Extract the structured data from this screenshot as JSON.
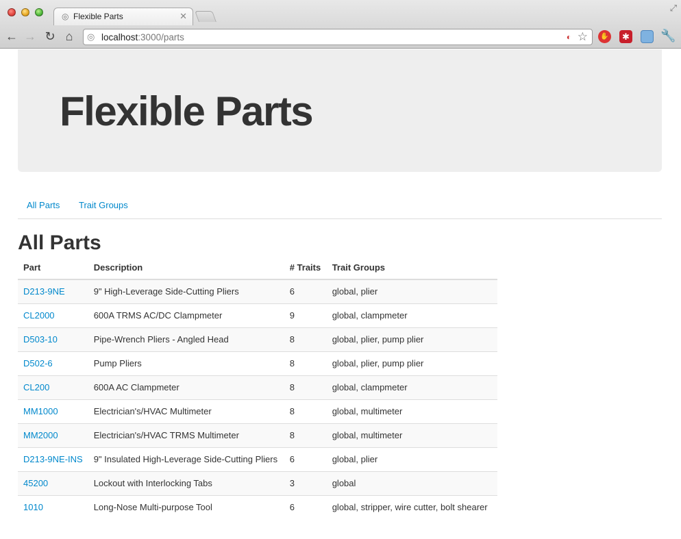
{
  "browser": {
    "tab_title": "Flexible Parts",
    "url_host": "localhost",
    "url_path": ":3000/parts"
  },
  "hero": {
    "title": "Flexible Parts"
  },
  "nav": {
    "all_parts": "All Parts",
    "trait_groups": "Trait Groups"
  },
  "page": {
    "title": "All Parts"
  },
  "table": {
    "headers": [
      "Part",
      "Description",
      "# Traits",
      "Trait Groups"
    ],
    "rows": [
      [
        "D213-9NE",
        "9\" High-Leverage Side-Cutting Pliers",
        "6",
        "global, plier"
      ],
      [
        "CL2000",
        "600A TRMS AC/DC Clampmeter",
        "9",
        "global, clampmeter"
      ],
      [
        "D503-10",
        "Pipe-Wrench Pliers - Angled Head",
        "8",
        "global, plier, pump plier"
      ],
      [
        "D502-6",
        "Pump Pliers",
        "8",
        "global, plier, pump plier"
      ],
      [
        "CL200",
        "600A AC Clampmeter",
        "8",
        "global, clampmeter"
      ],
      [
        "MM1000",
        "Electrician's/HVAC Multimeter",
        "8",
        "global, multimeter"
      ],
      [
        "MM2000",
        "Electrician's/HVAC TRMS Multimeter",
        "8",
        "global, multimeter"
      ],
      [
        "D213-9NE-INS",
        "9\" Insulated High-Leverage Side-Cutting Pliers",
        "6",
        "global, plier"
      ],
      [
        "45200",
        "Lockout with Interlocking Tabs",
        "3",
        "global"
      ],
      [
        "1010",
        "Long-Nose Multi-purpose Tool",
        "6",
        "global, stripper, wire cutter, bolt shearer"
      ]
    ]
  },
  "colors": {
    "link": "#0088cc",
    "hero_bg": "#eeeeee",
    "text": "#333333"
  },
  "icons": [
    "globe-icon",
    "close-icon",
    "back-arrow-icon",
    "forward-arrow-icon",
    "reload-icon",
    "home-icon",
    "star-icon",
    "stop-extension-icon",
    "lastpass-icon",
    "folder-icon",
    "wrench-icon",
    "expand-icon"
  ]
}
